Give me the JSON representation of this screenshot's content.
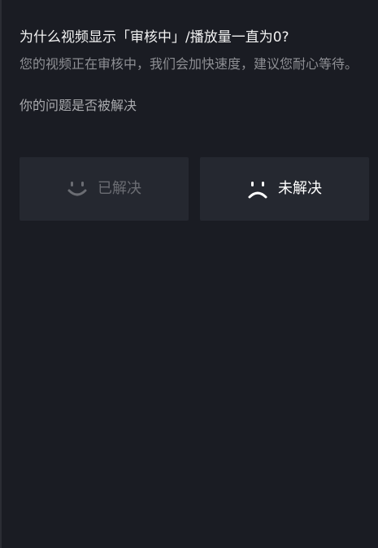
{
  "faq": {
    "title": "为什么视频显示「审核中」/播放量一直为0?",
    "description": "您的视频正在审核中，我们会加快速度，建议您耐心等待。",
    "question": "你的问题是否被解决",
    "buttons": {
      "resolved_label": "已解决",
      "unresolved_label": "未解决",
      "resolved_icon": "smile-icon",
      "unresolved_icon": "frown-icon"
    }
  },
  "colors": {
    "background": "#1a1c23",
    "button_background": "#252830",
    "muted_text": "#6b6d73",
    "secondary_text": "#8e8f94"
  }
}
